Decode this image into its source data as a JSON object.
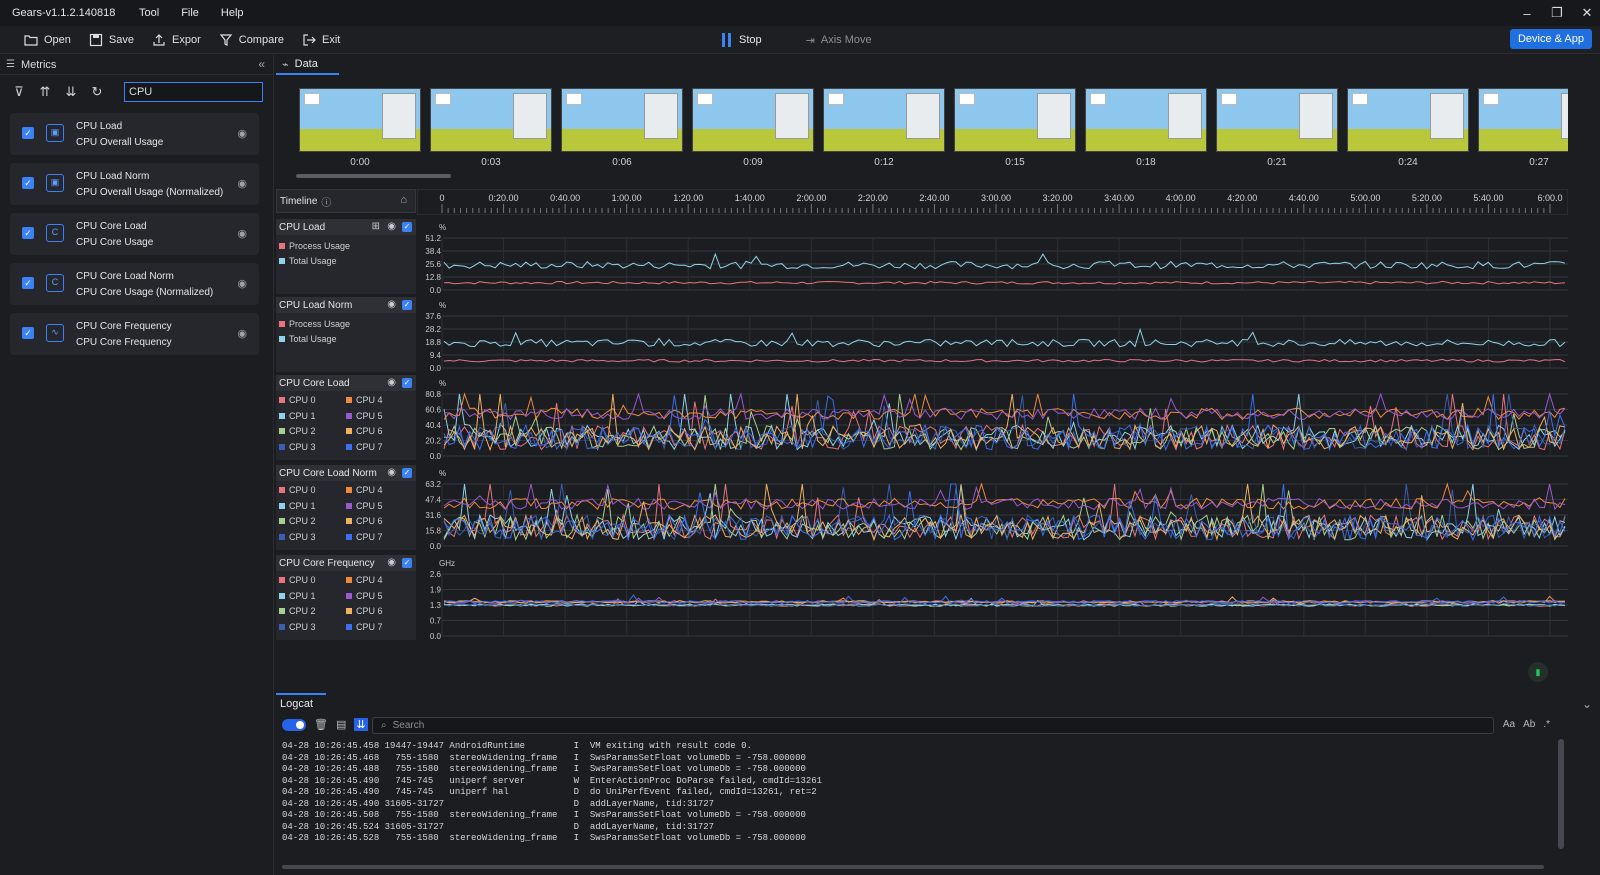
{
  "app": {
    "title": "Gears-v1.1.2.140818",
    "menu": [
      "Tool",
      "File",
      "Help"
    ]
  },
  "toolbar": {
    "open": "Open",
    "save": "Save",
    "export": "Expor",
    "compare": "Compare",
    "exit": "Exit",
    "stop": "Stop",
    "axis_move": "Axis Move",
    "device_app": "Device & App"
  },
  "sidebar": {
    "title": "Metrics",
    "search_value": "CPU",
    "metrics": [
      {
        "name": "CPU Load",
        "desc": "CPU Overall Usage"
      },
      {
        "name": "CPU Load Norm",
        "desc": "CPU Overall Usage (Normalized)"
      },
      {
        "name": "CPU Core Load",
        "desc": "CPU Core Usage"
      },
      {
        "name": "CPU Core Load Norm",
        "desc": "CPU Core Usage (Normalized)"
      },
      {
        "name": "CPU Core Frequency",
        "desc": "CPU Core Frequency"
      }
    ]
  },
  "data_tab": "Data",
  "thumbnails": [
    "0:00",
    "0:03",
    "0:06",
    "0:09",
    "0:12",
    "0:15",
    "0:18",
    "0:21",
    "0:24",
    "0:27"
  ],
  "timeline": {
    "label": "Timeline",
    "ticks": [
      "0",
      "0:20.00",
      "0:40.00",
      "1:00.00",
      "1:20.00",
      "1:40.00",
      "2:00.00",
      "2:20.00",
      "2:40.00",
      "3:00.00",
      "3:20.00",
      "3:40.00",
      "4:00.00",
      "4:20.00",
      "4:40.00",
      "5:00.00",
      "5:20.00",
      "5:40.00",
      "6:00.0"
    ]
  },
  "colors": {
    "cpu0": "#e8747e",
    "cpu1": "#8fd3e8",
    "cpu2": "#a8d08d",
    "cpu3": "#3a5fb0",
    "cpu4": "#f08a3a",
    "cpu5": "#9b59d0",
    "cpu6": "#f0b060",
    "cpu7": "#3b6ff0",
    "process": "#e8747e",
    "total": "#8fd3e8",
    "accent": "#3b82f6"
  },
  "panels": [
    {
      "title": "CPU Load",
      "unit": "%",
      "yticks": [
        "51.2",
        "38.4",
        "25.6",
        "12.8",
        "0.0"
      ],
      "legend": [
        "Process Usage",
        "Total Usage"
      ]
    },
    {
      "title": "CPU Load Norm",
      "unit": "%",
      "yticks": [
        "37.6",
        "28.2",
        "18.8",
        "9.4",
        "0.0"
      ],
      "legend": [
        "Process Usage",
        "Total Usage"
      ]
    },
    {
      "title": "CPU Core Load",
      "unit": "%",
      "yticks": [
        "80.8",
        "60.6",
        "40.4",
        "20.2",
        "0.0"
      ],
      "legend": [
        "CPU 0",
        "CPU 1",
        "CPU 2",
        "CPU 3",
        "CPU 4",
        "CPU 5",
        "CPU 6",
        "CPU 7"
      ]
    },
    {
      "title": "CPU Core Load Norm",
      "unit": "%",
      "yticks": [
        "63.2",
        "47.4",
        "31.6",
        "15.8",
        "0.0"
      ],
      "legend": [
        "CPU 0",
        "CPU 1",
        "CPU 2",
        "CPU 3",
        "CPU 4",
        "CPU 5",
        "CPU 6",
        "CPU 7"
      ]
    },
    {
      "title": "CPU Core Frequency",
      "unit": "GHz",
      "yticks": [
        "2.6",
        "1.9",
        "1.3",
        "0.7",
        "0.0"
      ],
      "legend": [
        "CPU 0",
        "CPU 1",
        "CPU 2",
        "CPU 3",
        "CPU 4",
        "CPU 5",
        "CPU 6",
        "CPU 7"
      ]
    }
  ],
  "logcat": {
    "tab": "Logcat",
    "search_placeholder": "Search",
    "right_icons": [
      "Aa",
      "Ab",
      ".*"
    ],
    "lines": [
      "04-28 10:26:45.458 19447-19447 AndroidRuntime         I  VM exiting with result code 0.",
      "04-28 10:26:45.468   755-1580  stereoWidening_frame   I  SwsParamsSetFloat volumeDb = -758.000000",
      "04-28 10:26:45.488   755-1580  stereoWidening_frame   I  SwsParamsSetFloat volumeDb = -758.000000",
      "04-28 10:26:45.490   745-745   uniperf server         W  EnterActionProc DoParse failed, cmdId=13261",
      "04-28 10:26:45.490   745-745   uniperf hal            D  do UniPerfEvent failed, cmdId=13261, ret=2",
      "04-28 10:26:45.490 31605-31727                        D  addLayerName, tid:31727",
      "04-28 10:26:45.508   755-1580  stereoWidening_frame   I  SwsParamsSetFloat volumeDb = -758.000000",
      "04-28 10:26:45.524 31605-31727                        D  addLayerName, tid:31727",
      "04-28 10:26:45.528   755-1580  stereoWidening_frame   I  SwsParamsSetFloat volumeDb = -758.000000"
    ]
  }
}
